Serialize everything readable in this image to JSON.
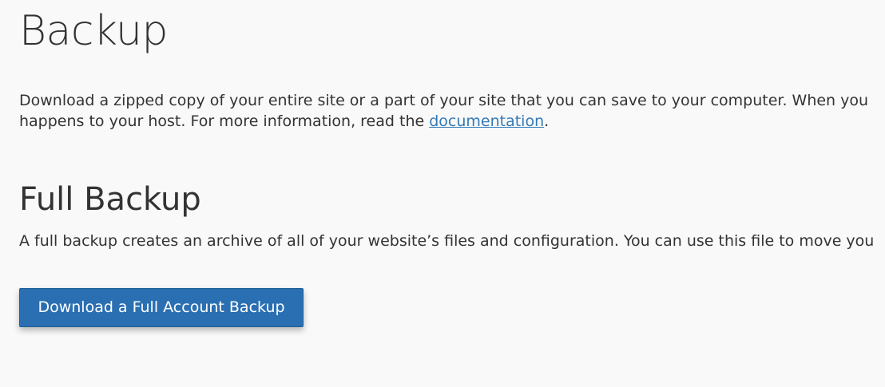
{
  "page": {
    "title": "Backup"
  },
  "intro": {
    "text_before_link": "Download a zipped copy of your entire site or a part of your site that you can save to your computer. When you ",
    "text_line2_start": "happens to your host. For more information, read the ",
    "link_text": "documentation",
    "text_after_link": "."
  },
  "full_backup": {
    "heading": "Full Backup",
    "description": "A full backup creates an archive of all of your website’s files and configuration. You can use this file to move you",
    "button_label": "Download a Full Account Backup"
  },
  "colors": {
    "background": "#f9f9f9",
    "text": "#333333",
    "link": "#337ab7",
    "primary_button": "#2a6fb2"
  }
}
